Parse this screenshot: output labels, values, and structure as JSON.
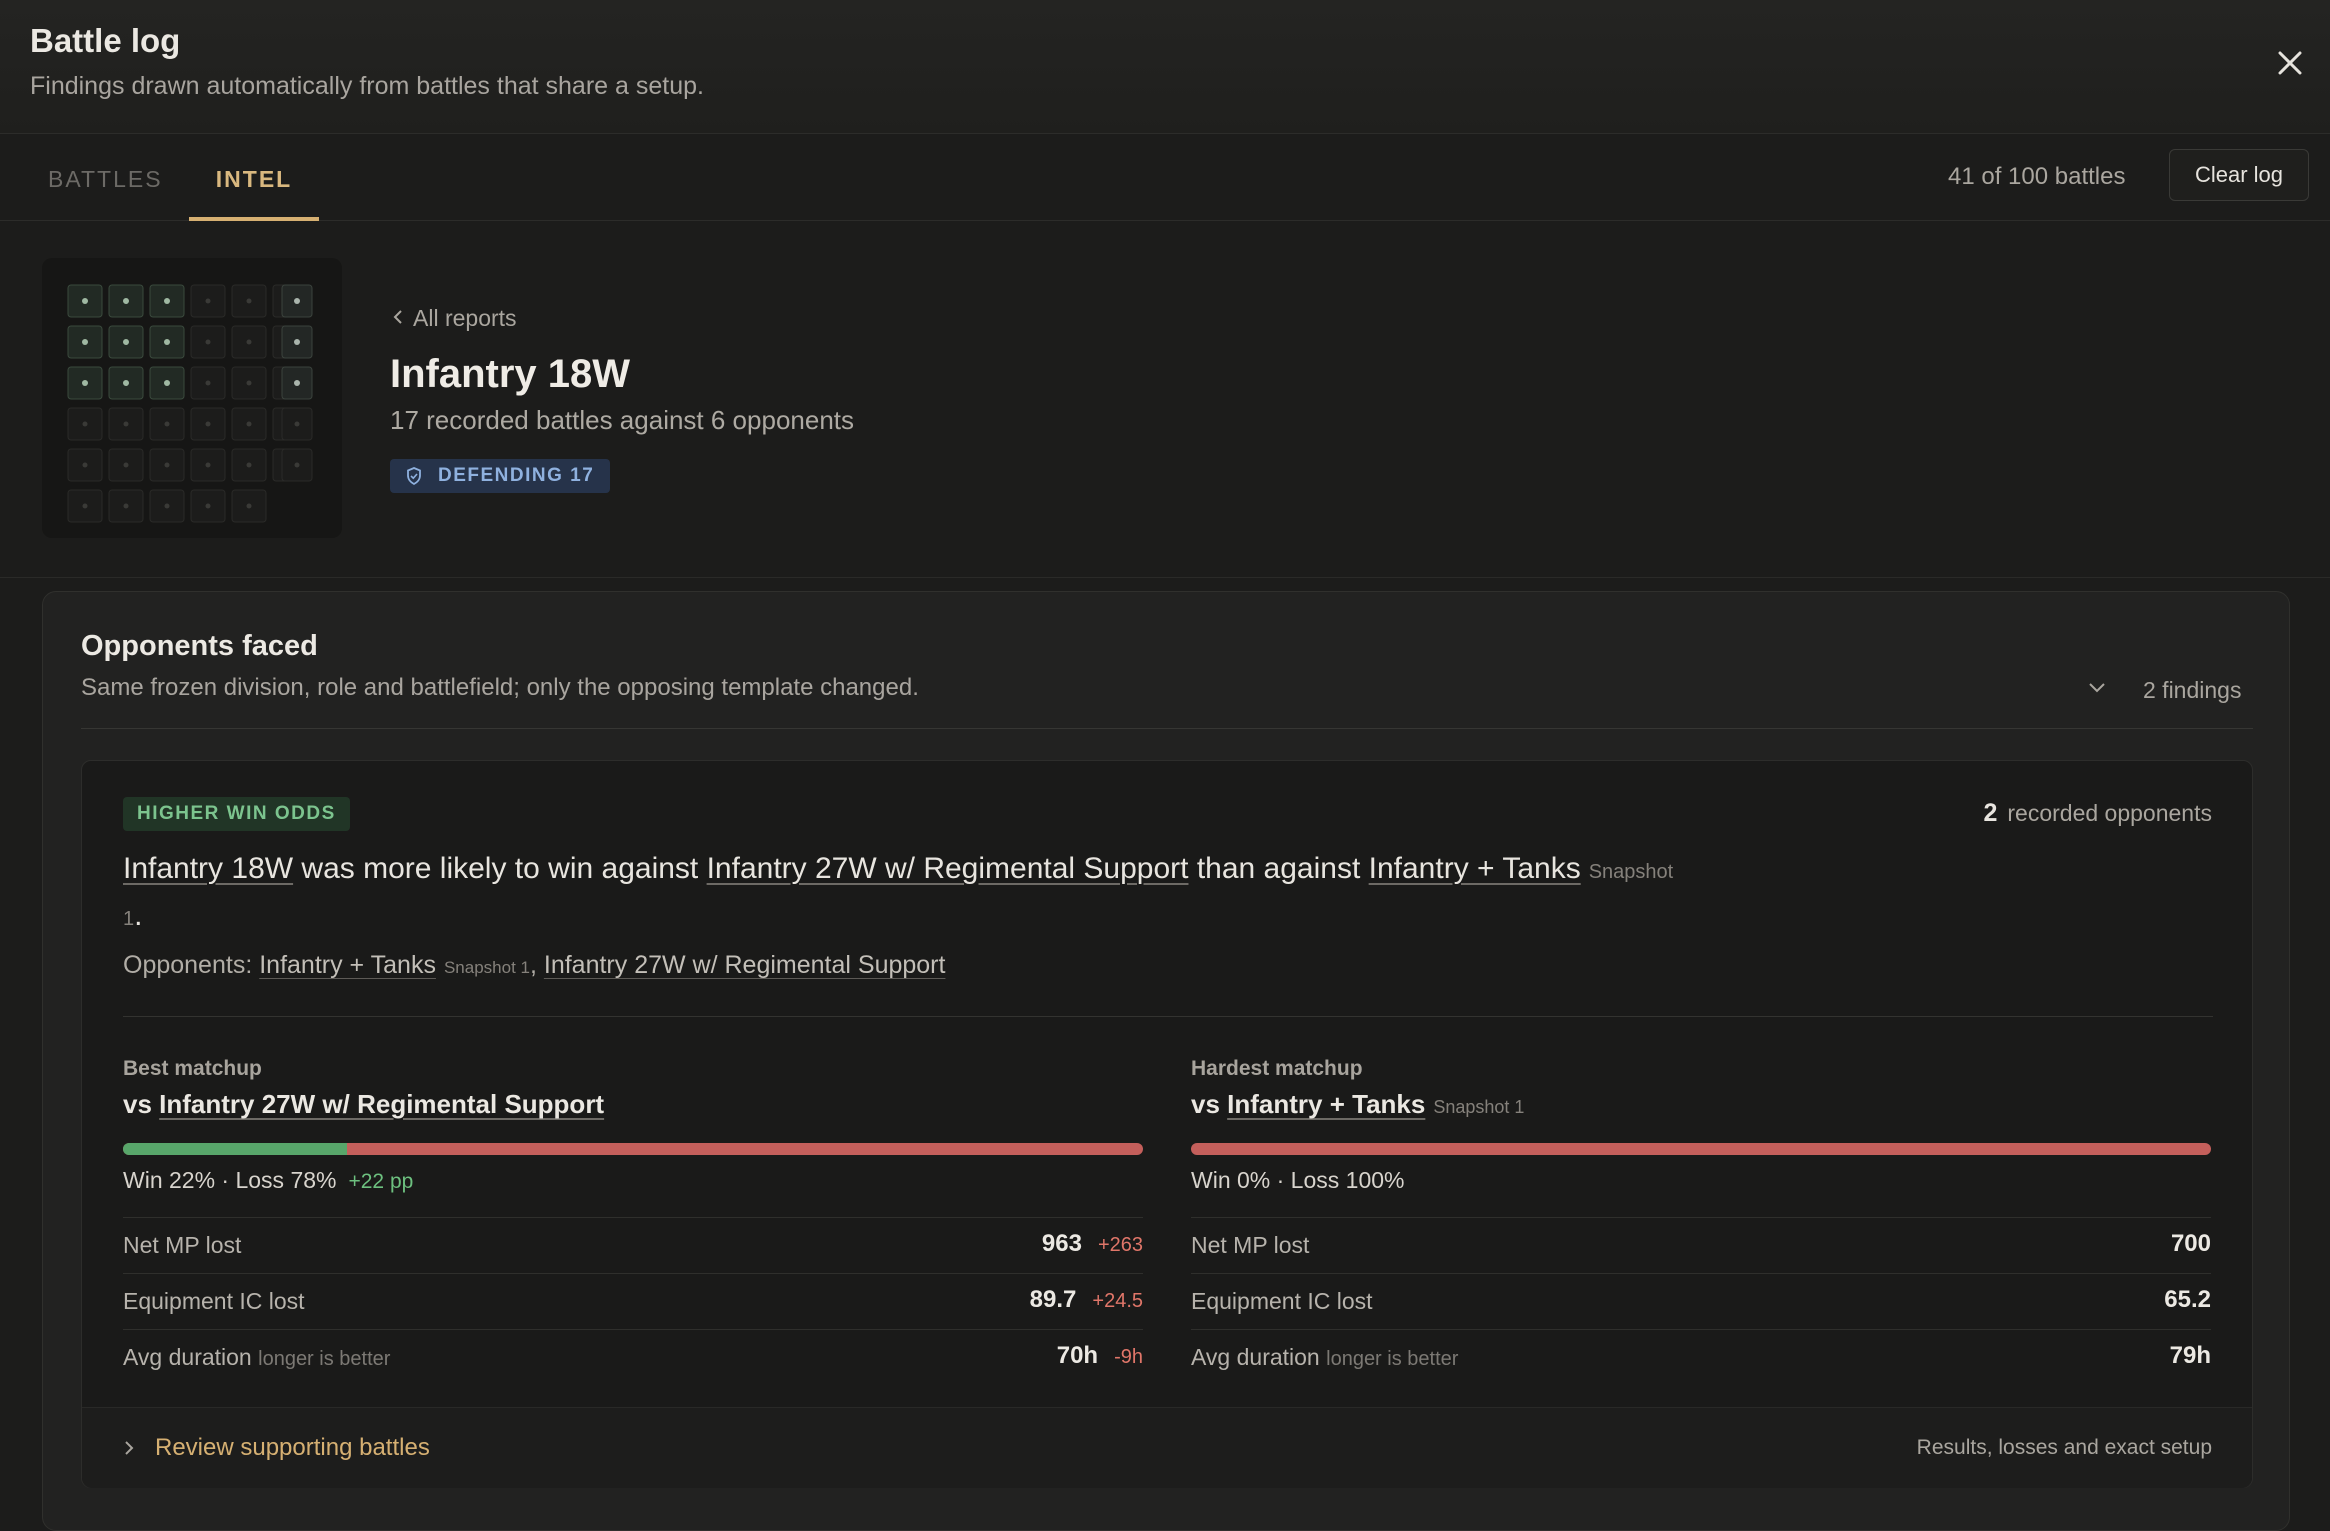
{
  "header": {
    "title": "Battle log",
    "subtitle": "Findings drawn automatically from battles that share a setup.",
    "close_icon": "close-icon"
  },
  "tabs": {
    "battles": "BATTLES",
    "intel": "INTEL",
    "active": "INTEL"
  },
  "toolbar": {
    "battle_count": "41 of 100 battles",
    "clear_label": "Clear log"
  },
  "report": {
    "back_label": "All reports",
    "title": "Infantry 18W",
    "summary": "17 recorded battles against 6 opponents",
    "badge": "DEFENDING 17"
  },
  "section": {
    "title": "Opponents faced",
    "subtitle": "Same frozen division, role and battlefield; only the opposing template changed.",
    "findings": "2 findings"
  },
  "finding": {
    "badge": "HIGHER WIN ODDS",
    "opponent_count": "2",
    "opponent_count_label": "recorded opponents",
    "headline": {
      "subject": "Infantry 18W",
      "mid1": "was more likely to win against",
      "best": "Infantry 27W w/ Regimental Support",
      "mid2": "than against",
      "worst": "Infantry + Tanks",
      "worst_snapshot": "Snapshot 1",
      "end": "."
    },
    "opponents_label": "Opponents:",
    "opponents": [
      {
        "name": "Infantry + Tanks",
        "snapshot": "Snapshot 1"
      },
      {
        "name": "Infantry 27W w/ Regimental Support",
        "snapshot": ""
      }
    ],
    "best": {
      "label": "Best matchup",
      "vs": "vs",
      "opponent": "Infantry 27W w/ Regimental Support",
      "snapshot": "",
      "win_fraction": 0.22,
      "record": "Win 22% · Loss 78%",
      "pp": "+22 pp",
      "stats": [
        {
          "label": "Net MP lost",
          "hint": "",
          "value": "963",
          "delta": "+263"
        },
        {
          "label": "Equipment IC lost",
          "hint": "",
          "value": "89.7",
          "delta": "+24.5"
        },
        {
          "label": "Avg duration",
          "hint": "longer is better",
          "value": "70h",
          "delta": "-9h"
        }
      ]
    },
    "hardest": {
      "label": "Hardest matchup",
      "vs": "vs",
      "opponent": "Infantry + Tanks",
      "snapshot": "Snapshot 1",
      "win_fraction": 0.0,
      "record": "Win 0% · Loss 100%",
      "stats": [
        {
          "label": "Net MP lost",
          "hint": "",
          "value": "700"
        },
        {
          "label": "Equipment IC lost",
          "hint": "",
          "value": "65.2"
        },
        {
          "label": "Avg duration",
          "hint": "longer is better",
          "value": "79h"
        }
      ]
    },
    "review_label": "Review supporting battles",
    "review_note": "Results, losses and exact setup"
  },
  "colors": {
    "accent": "#d6b072",
    "win": "#58a66a",
    "loss": "#c45f5b",
    "positive": "#6dc07f",
    "negative": "#e07669"
  }
}
